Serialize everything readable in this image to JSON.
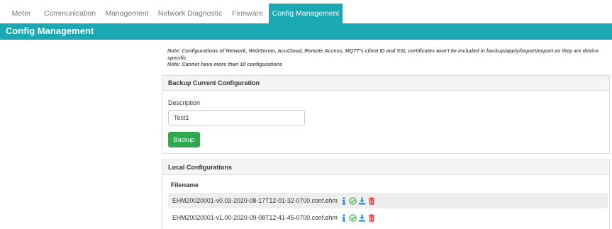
{
  "tabs": [
    {
      "label": "Meter",
      "active": false
    },
    {
      "label": "Communication",
      "active": false
    },
    {
      "label": "Management",
      "active": false
    },
    {
      "label": "Network Diagnostic",
      "active": false
    },
    {
      "label": "Firmware",
      "active": false
    },
    {
      "label": "Config Management",
      "active": true
    }
  ],
  "page": {
    "title": "Config Management"
  },
  "notes": {
    "line1": "Note: Configurations of Network, WebServer, AcuCloud, Remote Access, MQTT's client ID and SSL certificates won't be included in backup/apply/import/export as they are device specific",
    "line2": "Note: Cannot have more than 10 configurations"
  },
  "backup": {
    "header": "Backup Current Configuration",
    "description_label": "Description",
    "description_value": "Test1",
    "button_label": "Backup"
  },
  "local": {
    "header": "Local Configurations",
    "column": "Filename",
    "files": [
      "EHM20020001-v0.03-2020-08-17T12-01-32-0700.conf.ehm",
      "EHM20020001-v1.00-2020-09-08T12-41-45-0700.conf.ehm"
    ]
  },
  "colors": {
    "accent": "#1aa9b3",
    "button_green": "#2fa84f",
    "info_blue": "#1e88e5",
    "apply_green": "#34b233",
    "delete_red": "#e53935"
  },
  "icons": [
    "info-icon",
    "apply-check-icon",
    "download-icon",
    "trash-icon"
  ]
}
